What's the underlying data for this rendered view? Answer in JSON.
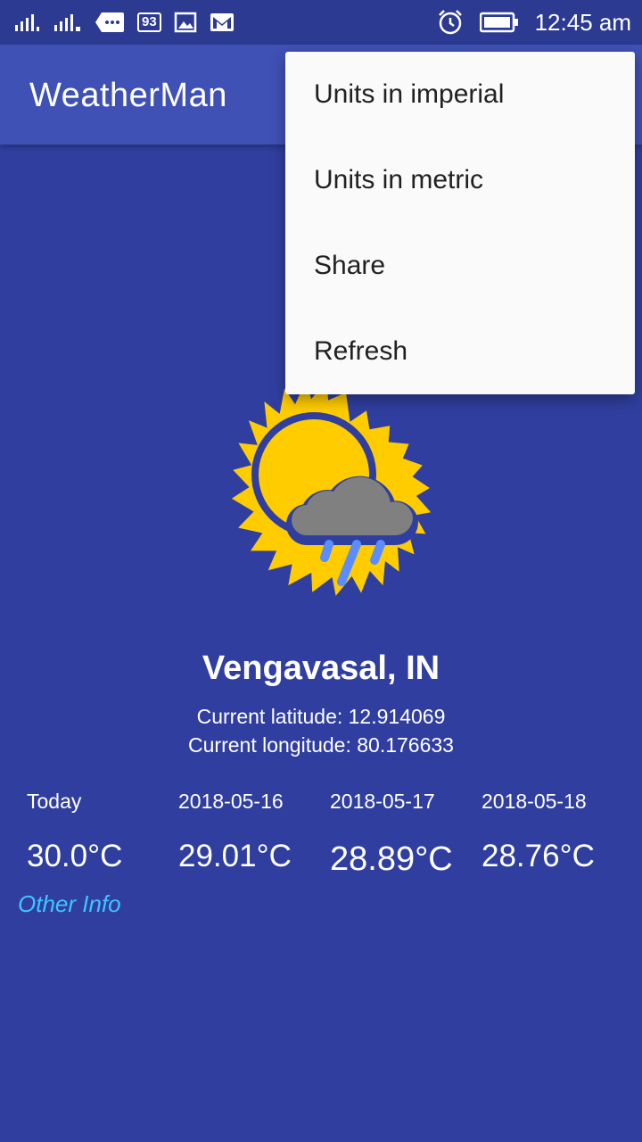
{
  "status_bar": {
    "battery_percent": "93",
    "time": "12:45 am"
  },
  "app_bar": {
    "title": "WeatherMan"
  },
  "weather": {
    "icon": "sun-cloud-rain-icon",
    "city": "Vengavasal, IN",
    "latitude_text": "Current latitude: 12.914069",
    "longitude_text": "Current longitude: 80.176633"
  },
  "forecast": [
    {
      "day": "Today",
      "temp": "30.0°C"
    },
    {
      "day": "2018-05-16",
      "temp": "29.01°C"
    },
    {
      "day": "2018-05-17",
      "temp": "28.89°C"
    },
    {
      "day": "2018-05-18",
      "temp": "28.76°C"
    }
  ],
  "other_info_label": "Other Info",
  "menu": {
    "items": [
      {
        "label": "Units in imperial"
      },
      {
        "label": "Units in metric"
      },
      {
        "label": "Share"
      },
      {
        "label": "Refresh"
      }
    ]
  },
  "colors": {
    "background": "#303f9f",
    "app_bar": "#3f51b5",
    "status_bar": "#2c3a92",
    "link": "#40c4ff",
    "sun": "#ffcc00",
    "cloud": "#808080",
    "rain": "#5c8dff",
    "menu_bg": "#fafafa"
  }
}
